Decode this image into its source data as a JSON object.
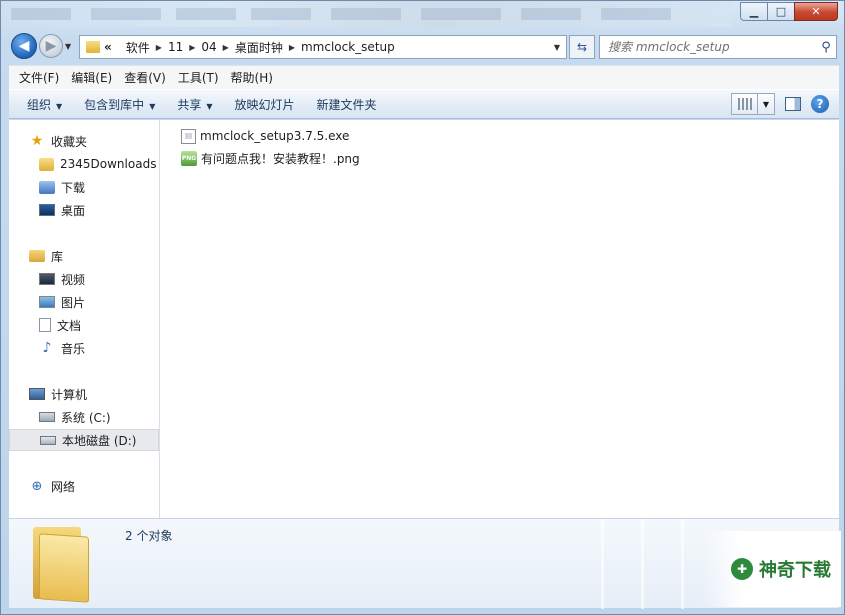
{
  "window": {
    "minimize": "▁",
    "maximize": "□",
    "close": "✕"
  },
  "address": {
    "overflow": "«",
    "crumbs": [
      "软件",
      "11",
      "04",
      "桌面时钟",
      "mmclock_setup"
    ],
    "separator": "▶",
    "dropdown": "▼"
  },
  "search": {
    "placeholder": "搜索 mmclock_setup"
  },
  "menubar": {
    "items": [
      "文件(F)",
      "编辑(E)",
      "查看(V)",
      "工具(T)",
      "帮助(H)"
    ]
  },
  "commandbar": {
    "organize": "组织",
    "include_library": "包含到库中",
    "share": "共享",
    "slideshow": "放映幻灯片",
    "new_folder": "新建文件夹"
  },
  "navpane": {
    "favorites": {
      "label": "收藏夹",
      "items": [
        "2345Downloads",
        "下载",
        "桌面"
      ]
    },
    "libraries": {
      "label": "库",
      "items": [
        "视频",
        "图片",
        "文档",
        "音乐"
      ]
    },
    "computer": {
      "label": "计算机",
      "items": [
        "系统 (C:)",
        "本地磁盘 (D:)"
      ]
    },
    "network": {
      "label": "网络"
    }
  },
  "files": [
    {
      "name": "mmclock_setup3.7.5.exe",
      "type": "exe"
    },
    {
      "name": "有问题点我！安装教程！.png",
      "type": "png"
    }
  ],
  "details": {
    "count": "2 个对象"
  },
  "watermark": {
    "logo": "✚",
    "text": "神奇下载"
  },
  "colors": {
    "accent": "#1f62b8",
    "watermark": "#2a7a35"
  }
}
